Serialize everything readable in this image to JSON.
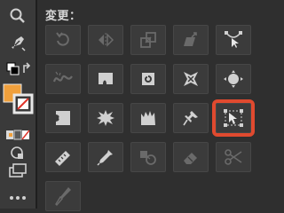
{
  "panel": {
    "title": "変更："
  },
  "colors": {
    "highlight": "#e04a2f",
    "fill_swatch": "#f0a03c",
    "panel_bg": "#2f2f2f",
    "cell_bg": "#3b3b3b"
  },
  "toolbar": {
    "items": [
      {
        "icon": "zoom-icon"
      },
      {
        "icon": "pen-icon"
      },
      {
        "icon": "swap-fill-stroke-icon"
      },
      {
        "icon": "fill-stroke-swatch-icon"
      },
      {
        "icon": "color-mode-icon"
      },
      {
        "icon": "draw-mode-icon"
      },
      {
        "icon": "screen-mode-icon"
      },
      {
        "icon": "more-tools-icon"
      }
    ]
  },
  "tools": [
    {
      "icon": "rotate-icon",
      "enabled": false
    },
    {
      "icon": "reflect-icon",
      "enabled": false
    },
    {
      "icon": "scale-icon",
      "enabled": false
    },
    {
      "icon": "shear-icon",
      "enabled": false
    },
    {
      "icon": "reshape-icon",
      "enabled": true
    },
    {
      "icon": "width-icon",
      "enabled": false
    },
    {
      "icon": "warp-icon",
      "enabled": true
    },
    {
      "icon": "twirl-icon",
      "enabled": true
    },
    {
      "icon": "pucker-icon",
      "enabled": true
    },
    {
      "icon": "bloat-icon",
      "enabled": true
    },
    {
      "icon": "scallop-icon",
      "enabled": true
    },
    {
      "icon": "crystallize-icon",
      "enabled": true
    },
    {
      "icon": "wrinkle-icon",
      "enabled": true
    },
    {
      "icon": "puppet-warp-icon",
      "enabled": true
    },
    {
      "icon": "free-transform-icon",
      "enabled": true,
      "highlighted": true
    },
    {
      "icon": "measure-icon",
      "enabled": true
    },
    {
      "icon": "eyedropper-icon",
      "enabled": true
    },
    {
      "icon": "blend-icon",
      "enabled": false
    },
    {
      "icon": "eraser-icon",
      "enabled": false
    },
    {
      "icon": "scissors-icon",
      "enabled": false
    },
    {
      "icon": "knife-icon",
      "enabled": false
    }
  ]
}
